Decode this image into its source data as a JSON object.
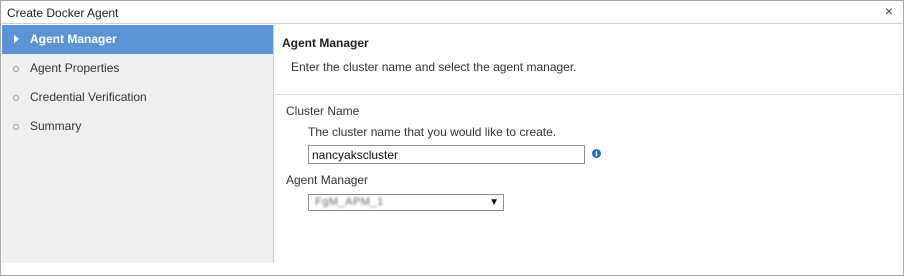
{
  "dialog": {
    "title": "Create Docker Agent",
    "close_glyph": "×"
  },
  "steps": [
    {
      "label": "Agent Manager",
      "active": true
    },
    {
      "label": "Agent Properties",
      "active": false
    },
    {
      "label": "Credential Verification",
      "active": false
    },
    {
      "label": "Summary",
      "active": false
    }
  ],
  "page": {
    "title": "Agent Manager",
    "description": "Enter the cluster name and select the agent manager."
  },
  "form": {
    "cluster_name_label": "Cluster Name",
    "cluster_name_help": "The cluster name that you would like to create.",
    "cluster_name_value": "nancyakscluster",
    "info_icon": "i",
    "agent_manager_label": "Agent Manager",
    "agent_manager_value": "FgM_APM_1",
    "dropdown_caret": "▼"
  },
  "icons": {
    "close": "close-icon",
    "info": "info-icon",
    "active_step": "arrow-right-icon",
    "step_bullet": "circle-bullet-icon"
  },
  "colors": {
    "active_step_bg": "#5b94d6",
    "sidebar_bg": "#efefef",
    "info_icon": "#1f6fc4"
  }
}
